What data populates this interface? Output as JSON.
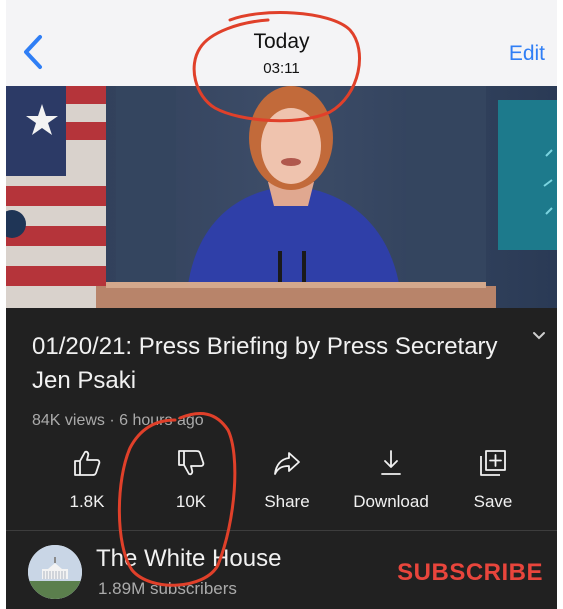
{
  "nav": {
    "title": "Today",
    "subtitle": "03:11",
    "edit_label": "Edit"
  },
  "video": {
    "title": "01/20/21: Press Briefing by Press Secretary Jen Psaki",
    "meta": "84K views · 6 hours ago"
  },
  "actions": [
    {
      "icon": "thumbs-up-icon",
      "label": "1.8K"
    },
    {
      "icon": "thumbs-down-icon",
      "label": "10K"
    },
    {
      "icon": "share-icon",
      "label": "Share"
    },
    {
      "icon": "download-icon",
      "label": "Download"
    },
    {
      "icon": "save-icon",
      "label": "Save"
    }
  ],
  "channel": {
    "name": "The White House",
    "subscribers": "1.89M subscribers",
    "subscribe_label": "SUBSCRIBE"
  },
  "colors": {
    "accent_blue": "#2f7ef5",
    "subscribe_red": "#e8453c",
    "annotation_red": "#e0402a",
    "background_dark": "#212121"
  }
}
